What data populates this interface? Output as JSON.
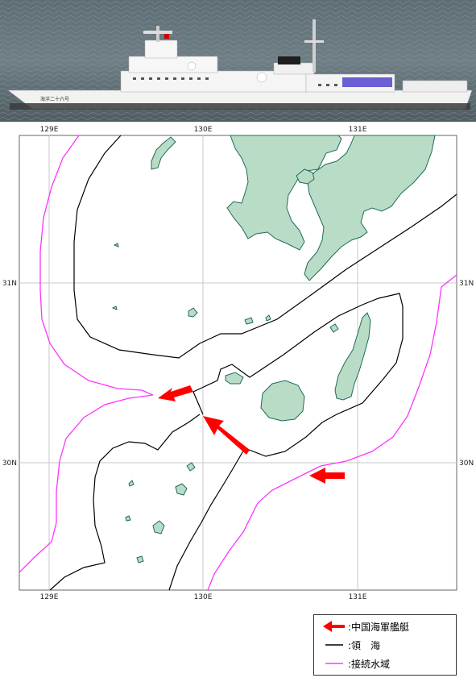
{
  "photo": {
    "caption": "",
    "hull_text": "海洋二十六号"
  },
  "map": {
    "longitude_ticks": [
      "129E",
      "130E",
      "131E"
    ],
    "latitude_ticks": [
      "31N",
      "30N"
    ],
    "colors": {
      "land": "#b9dcc6",
      "coast": "#1f6b58",
      "territorial_sea": "#000000",
      "contiguous_zone": "#ff33ff",
      "ship_arrow": "#ff0000",
      "grid": "#c8c8c8"
    },
    "arrows_count_shown": 3
  },
  "legend": {
    "items": [
      {
        "symbol": "red-arrow-icon",
        "label": ":中国海軍艦艇"
      },
      {
        "symbol": "black-line",
        "label": ":領　海"
      },
      {
        "symbol": "magenta-line",
        "label": ":接続水域"
      }
    ]
  }
}
